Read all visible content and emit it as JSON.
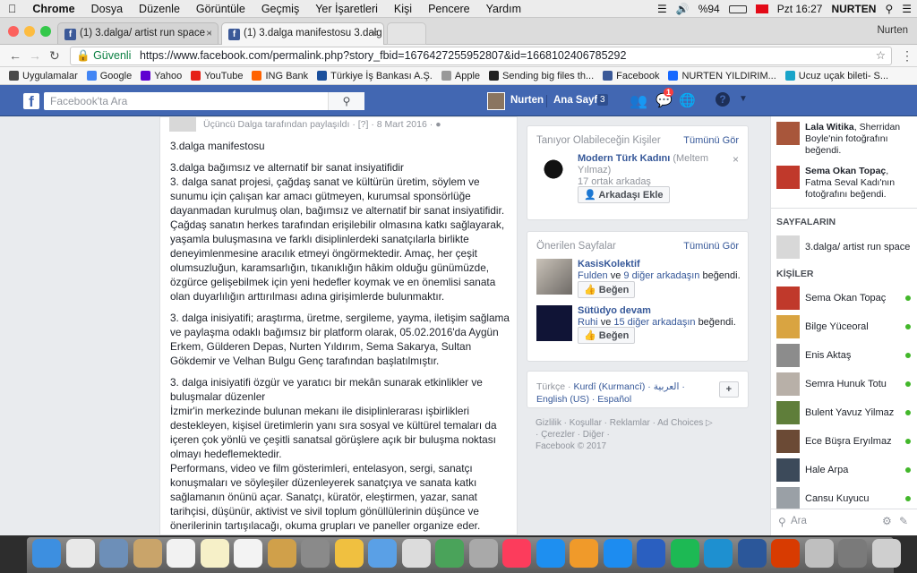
{
  "menubar": {
    "apple": "",
    "app": "Chrome",
    "menus": [
      "Dosya",
      "Düzenle",
      "Görüntüle",
      "Geçmiş",
      "Yer İşaretleri",
      "Kişi",
      "Pencere",
      "Yardım"
    ],
    "battery": "%94",
    "clock": "Pzt 16:27",
    "user": "NURTEN"
  },
  "tabs": [
    {
      "title": "(1) 3.dalga/ artist run space -"
    },
    {
      "title": "(1) 3.dalga manifestosu 3.dalg"
    }
  ],
  "profile": "Nurten",
  "omnibox": {
    "secure_label": "Güvenli",
    "url": "https://www.facebook.com/permalink.php?story_fbid=1676427255952807&id=1668102406785292"
  },
  "bookmarks": [
    {
      "label": "Uygulamalar",
      "color": "#4a4a4a"
    },
    {
      "label": "Google",
      "color": "#4285f4"
    },
    {
      "label": "Yahoo",
      "color": "#5f01d1"
    },
    {
      "label": "YouTube",
      "color": "#e62117"
    },
    {
      "label": "ING Bank",
      "color": "#ff6200"
    },
    {
      "label": "Türkiye İş Bankası A.Ş.",
      "color": "#1a4f9c"
    },
    {
      "label": "Apple",
      "color": "#999999"
    },
    {
      "label": "Sending big files th...",
      "color": "#222222"
    },
    {
      "label": "Facebook",
      "color": "#3b5998"
    },
    {
      "label": "NURTEN YILDIRIM...",
      "color": "#1769ff"
    },
    {
      "label": "Ucuz uçak bileti- S...",
      "color": "#19a4c9"
    }
  ],
  "fb": {
    "search_placeholder": "Facebook'ta Ara",
    "user": "Nurten",
    "home": "Ana Sayfa",
    "home_count": "3",
    "msg_badge": "1"
  },
  "post": {
    "header": "Üçüncü Dalga tarafından paylaşıldı · [?] · 8 Mart 2016 ·",
    "paragraphs": [
      "3.dalga manifestosu",
      "3.dalga bağımsız ve alternatif bir sanat insiyatifidir\n3. dalga sanat projesi, çağdaş sanat ve kültürün üretim, söylem ve sunumu için çalışan kar amacı gütmeyen, kurumsal sponsörlüğe dayanmadan kurulmuş olan, bağımsız ve alternatif bir sanat insiyatifidir. Çağdaş sanatın herkes tarafından erişilebilir olmasına katkı sağlayarak, yaşamla buluşmasına ve farklı disiplinlerdeki sanatçılarla birlikte deneyimlenmesine aracılık etmeyi öngörmektedir. Amaç, her çeşit olumsuzluğun, karamsarlığın, tıkanıklığın hâkim olduğu günümüzde, özgürce gelişebilmek için yeni hedefler koymak ve en önemlisi sanata olan duyarlılığın arttırılması adına girişimlerde bulunmaktır.",
      "3. dalga inisiyatifi; araştırma, üretme, sergileme, yayma, iletişim sağlama ve paylaşma odaklı bağımsız bir platform olarak, 05.02.2016'da Aygün Erkem, Gülderen Depas, Nurten Yıldırım, Sema Sakarya, Sultan Gökdemir ve Velhan Bulgu Genç tarafından başlatılmıştır.",
      "3. dalga inisiyatifi özgür ve yaratıcı bir mekân sunarak etkinlikler ve buluşmalar düzenler\nİzmir'in merkezinde bulunan mekanı ile disiplinlerarası işbirlikleri destekleyen, kişisel üretimlerin yanı sıra sosyal ve kültürel temaları da içeren çok yönlü ve çeşitli sanatsal görüşlere açık bir buluşma noktası olmayı hedeflemektedir.\nPerformans, video ve film gösterimleri, entelasyon, sergi, sanatçı konuşmaları ve söyleşiler düzenleyerek sanatçıya ve sanata katkı sağlamanın önünü açar. Sanatçı, küratör, eleştirmen, yazar, sanat tarihçisi, düşünür, aktivist ve sivil toplum gönüllülerinin düşünce ve önerilerinin tartışılacağı, okuma grupları ve paneller organize eder. Hedef eleştirel bir ortam içinde sanat kuramlarının, güncel sanat pratiklerinin ve politikalarının tartışıldığı bir platform yaratmaktır."
    ]
  },
  "pymk": {
    "title": "Tanıyor Olabileceğin Kişiler",
    "see_all": "Tümünü Gör",
    "name": "Modern Türk Kadını",
    "alias": "(Meltem Yılmaz)",
    "mutual": "17 ortak arkadaş",
    "button": "Arkadaşı Ekle"
  },
  "pages": {
    "title": "Önerilen Sayfalar",
    "see_all": "Tümünü Gör",
    "items": [
      {
        "name": "KasisKolektif",
        "liker": "Fulden",
        "and": "ve",
        "others": "9 diğer arkadaşın",
        "liked": "beğendi.",
        "button": "Beğen"
      },
      {
        "name": "Sütüdyo devam",
        "liker": "Ruhi",
        "and": "ve",
        "others": "15 diğer arkadaşın",
        "liked": "beğendi.",
        "button": "Beğen"
      }
    ]
  },
  "languages": {
    "current": "Türkçe ·",
    "others": [
      "Kurdî (Kurmancî) ·",
      "العربية ·",
      "English (US) ·",
      "Español"
    ]
  },
  "footer": {
    "links": "Gizlilik · Koşullar · Reklamlar · Ad Choices ▷ · Çerezler · Diğer ·",
    "copyright": "Facebook © 2017"
  },
  "sidebar": {
    "activity": [
      {
        "actor": "Lala Witika",
        "text": ", Sherridan Boyle'nin fotoğrafını beğendi."
      },
      {
        "actor": "Sema Okan Topaç",
        "text": ", Fatma Seval Kadı'nın fotoğrafını beğendi."
      }
    ],
    "pages_header": "SAYFALARIN",
    "page_name": "3.dalga/ artist run space",
    "contacts_header": "KİŞİLER",
    "contacts": [
      {
        "name": "Sema Okan Topaç",
        "color": "#c0392b"
      },
      {
        "name": "Bilge Yüceoral",
        "color": "#d9a441"
      },
      {
        "name": "Enis Aktaş",
        "color": "#8c8c8c"
      },
      {
        "name": "Semra Hunuk Totu",
        "color": "#b8b0a8"
      },
      {
        "name": "Bulent Yavuz Yilmaz",
        "color": "#5f7e3a"
      },
      {
        "name": "Ece Büşra Eryılmaz",
        "color": "#6b4a35"
      },
      {
        "name": "Hale Arpa",
        "color": "#3c4a5a"
      },
      {
        "name": "Cansu Kuyucu",
        "color": "#9aa0a6"
      }
    ],
    "search_placeholder": "Ara"
  }
}
